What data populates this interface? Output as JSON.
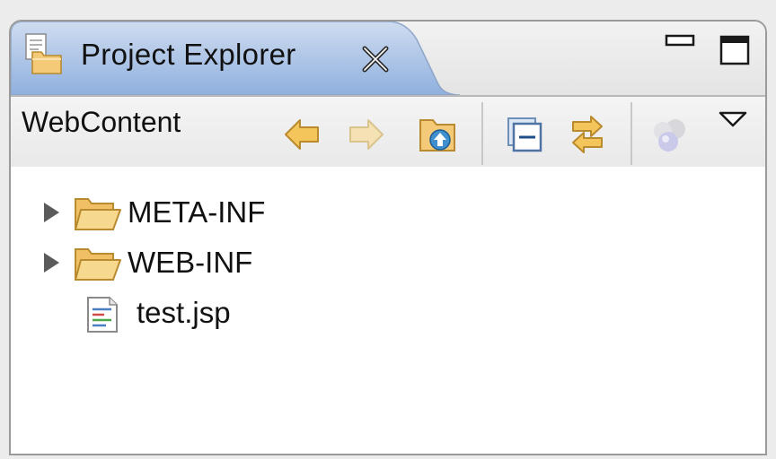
{
  "view": {
    "title": "Project Explorer",
    "tab_icon": "project-explorer-icon",
    "close_icon": "close-icon",
    "minimize_icon": "minimize-icon",
    "maximize_icon": "maximize-icon"
  },
  "toolbar": {
    "breadcrumb": "WebContent",
    "buttons": [
      {
        "name": "back-button",
        "icon": "arrow-left-icon",
        "enabled": true
      },
      {
        "name": "forward-button",
        "icon": "arrow-right-icon",
        "enabled": false
      },
      {
        "name": "up-button",
        "icon": "folder-up-icon",
        "enabled": true
      },
      {
        "name": "collapse-all-button",
        "icon": "collapse-all-icon",
        "enabled": true
      },
      {
        "name": "link-with-editor-button",
        "icon": "link-editor-icon",
        "enabled": true
      },
      {
        "name": "working-sets-button",
        "icon": "working-sets-icon",
        "enabled": false
      },
      {
        "name": "view-menu-button",
        "icon": "view-menu-icon",
        "enabled": true
      }
    ]
  },
  "tree": {
    "items": [
      {
        "label": "META-INF",
        "type": "folder",
        "expandable": true
      },
      {
        "label": "WEB-INF",
        "type": "folder",
        "expandable": true
      },
      {
        "label": "test.jsp",
        "type": "file",
        "expandable": false
      }
    ]
  },
  "colors": {
    "tab_active": "#b8cdea",
    "tab_active_dark": "#8fb0de",
    "folder_fill": "#f4c978",
    "folder_stroke": "#b98a2e",
    "arrow_enabled": "#f3c55a",
    "arrow_disabled": "#f4e2b4"
  }
}
